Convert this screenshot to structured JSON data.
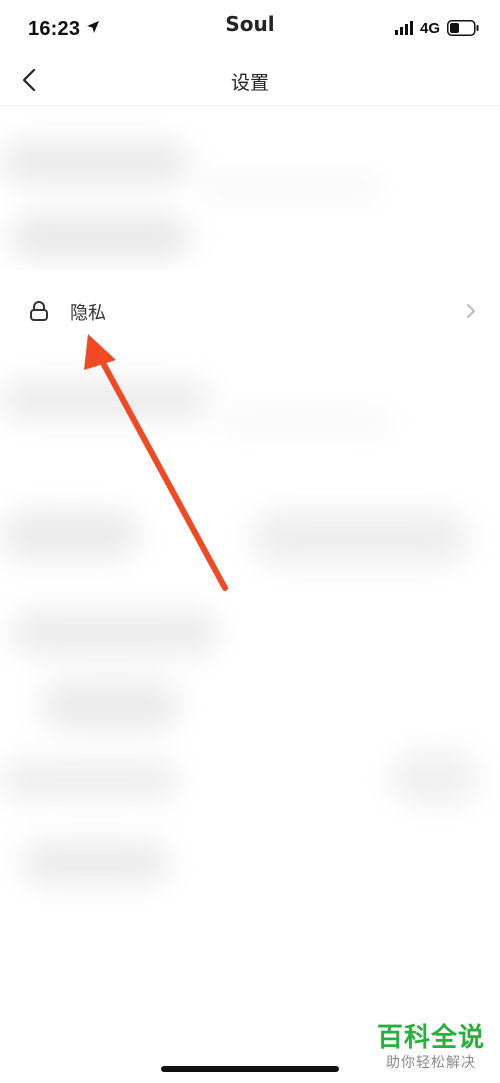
{
  "status_bar": {
    "time": "16:23",
    "app": "Soul",
    "network": "4G",
    "icons": [
      "location-arrow-icon",
      "cellular-signal-icon",
      "battery-icon"
    ]
  },
  "nav": {
    "back_icon": "chevron-left-icon",
    "title": "设置"
  },
  "privacy_row": {
    "icon": "lock-icon",
    "label": "隐私",
    "chevron": "chevron-right-icon"
  },
  "annotation": {
    "arrow_color": "#f04a24"
  },
  "watermark": {
    "title": "百科全说",
    "subtitle": "助你轻松解决",
    "color": "#27b03c"
  }
}
